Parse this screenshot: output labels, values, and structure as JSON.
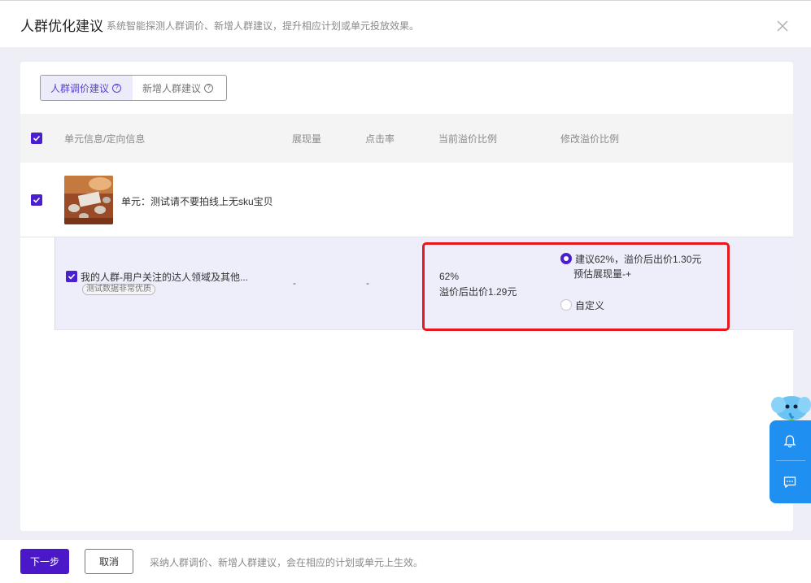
{
  "header": {
    "title": "人群优化建议",
    "subtitle": "系统智能探测人群调价、新增人群建议，提升相应计划或单元投放效果。"
  },
  "tabs": [
    {
      "label": "人群调价建议",
      "active": true
    },
    {
      "label": "新增人群建议",
      "active": false
    }
  ],
  "table": {
    "columns": [
      "单元信息/定向信息",
      "展现量",
      "点击率",
      "当前溢价比例",
      "修改溢价比例"
    ],
    "unit": {
      "label": "单元：测试请不要拍线上无sku宝贝",
      "checked": true
    },
    "audience": {
      "name": "我的人群-用户关注的达人领域及其他...",
      "tag": "测试数据非常优质",
      "impressions": "-",
      "ctr": "-",
      "current_pct": "62%",
      "current_price": "溢价后出价1.29元",
      "option_suggest": "建议62%，溢价后出价1.30元",
      "option_suggest_sub": "预估展现量-+",
      "option_custom": "自定义",
      "selected": "suggest"
    }
  },
  "footer": {
    "next_label": "下一步",
    "cancel_label": "取消",
    "note": "采纳人群调价、新增人群建议，会在相应的计划或单元上生效。"
  },
  "colors": {
    "accent": "#4a1fd0",
    "highlight": "#e8171e",
    "widget": "#1f8ff1"
  },
  "icons": [
    "close-icon",
    "question-icon",
    "check-icon",
    "bell-icon",
    "chat-icon",
    "mascot-icon"
  ]
}
